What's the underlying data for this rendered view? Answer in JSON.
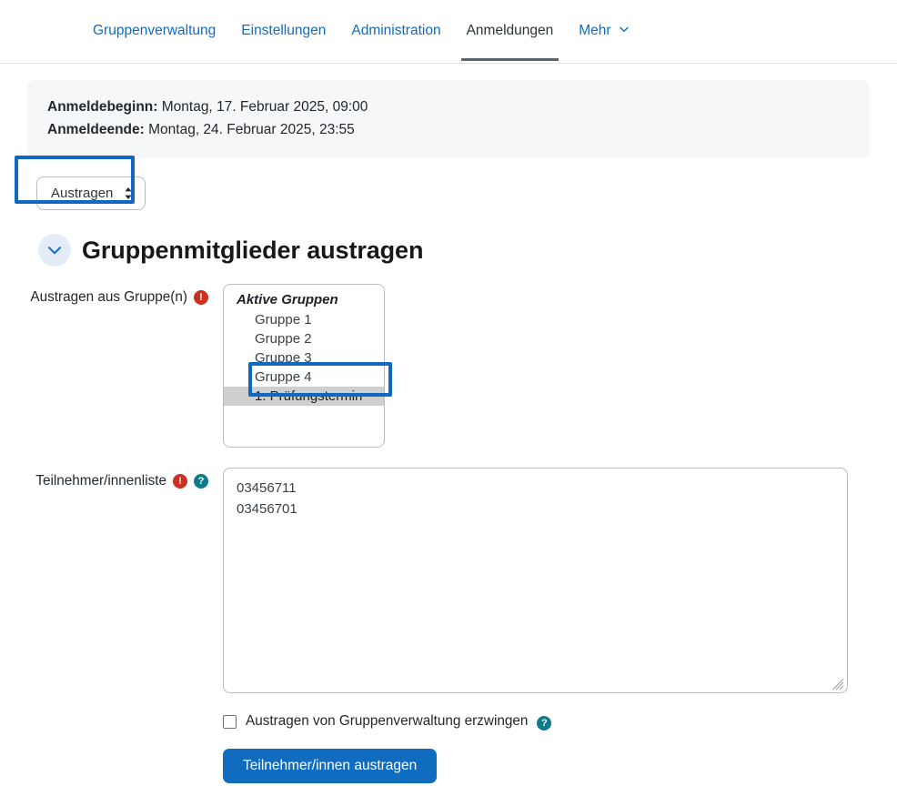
{
  "nav": {
    "tabs": [
      {
        "label": "Gruppenverwaltung",
        "active": false,
        "has_chevron": false
      },
      {
        "label": "Einstellungen",
        "active": false,
        "has_chevron": false
      },
      {
        "label": "Administration",
        "active": false,
        "has_chevron": false
      },
      {
        "label": "Anmeldungen",
        "active": true,
        "has_chevron": false
      },
      {
        "label": "Mehr",
        "active": false,
        "has_chevron": true
      }
    ]
  },
  "info": {
    "start_label": "Anmeldebeginn:",
    "start_value": "Montag, 17. Februar 2025, 09:00",
    "end_label": "Anmeldeende:",
    "end_value": "Montag, 24. Februar 2025, 23:55"
  },
  "action_select": {
    "value": "Austragen",
    "options": [
      "Austragen"
    ]
  },
  "section": {
    "title": "Gruppenmitglieder austragen",
    "collapsed": false
  },
  "group_field": {
    "label": "Austragen aus Gruppe(n)",
    "required_marker": "!",
    "optgroup_label": "Aktive Gruppen",
    "options": [
      {
        "label": "Gruppe 1",
        "selected": false
      },
      {
        "label": "Gruppe 2",
        "selected": false
      },
      {
        "label": "Gruppe 3",
        "selected": false
      },
      {
        "label": "Gruppe 4",
        "selected": false
      },
      {
        "label": "1. Prüfungstermin",
        "selected": true
      }
    ]
  },
  "participants_field": {
    "label": "Teilnehmer/innenliste",
    "required_marker": "!",
    "help_marker": "?",
    "value": "03456711\n03456701",
    "placeholder": ""
  },
  "force_checkbox": {
    "label": "Austragen von Gruppenverwaltung erzwingen",
    "checked": false,
    "help_marker": "?"
  },
  "submit": {
    "label": "Teilnehmer/innen austragen"
  },
  "colors": {
    "accent_blue": "#0f6cbf",
    "highlight_blue": "#1267c0",
    "required_red": "#ca3120",
    "help_teal": "#0f7b8a",
    "info_bg": "#f6f7f9",
    "selected_option_bg": "#cfcfcf"
  }
}
